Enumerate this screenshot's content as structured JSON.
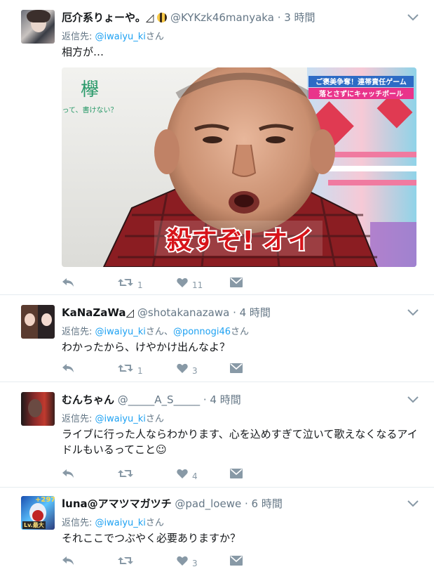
{
  "tweets": [
    {
      "name": "厄介系りょーや。◿",
      "handle": "@KYKzk46manyaka",
      "time": "· 3 時間",
      "reply_prefix": "返信先: ",
      "reply_users": [
        "@iwaiyu_ki"
      ],
      "reply_suffix": "さん",
      "text": "相方が…",
      "retweets": "1",
      "likes": "11",
      "media": {
        "caption_main": "殺すぞ! オイ",
        "side_kanji": "欅",
        "side_text": "って、書けない？",
        "banner_line1": "ご褒美争奪！連帯責任ゲーム",
        "banner_line2": "落とさずにキャッチボール"
      }
    },
    {
      "name": "KaNaZaWa◿",
      "handle": "@shotakanazawa",
      "time": "· 4 時間",
      "reply_prefix": "返信先: ",
      "reply_users": [
        "@iwaiyu_ki",
        "@ponnogi46"
      ],
      "reply_joiner": "さん、",
      "reply_suffix": "さん",
      "text": "わかったから、けやかけ出んなよ？",
      "retweets": "1",
      "likes": "3"
    },
    {
      "name": "むんちゃん",
      "handle": "@_____A_S_____",
      "time": "· 4 時間",
      "reply_prefix": "返信先: ",
      "reply_users": [
        "@iwaiyu_ki"
      ],
      "reply_suffix": "さん",
      "text": "ライブに行った人ならわかります、心を込めすぎて泣いて歌えなくなるアイドルもいるってこと☺",
      "retweets": "",
      "likes": "4"
    },
    {
      "name": "luna@アマツマガツチ",
      "handle": "@pad_loewe",
      "time": "· 6 時間",
      "reply_prefix": "返信先: ",
      "reply_users": [
        "@iwaiyu_ki"
      ],
      "reply_suffix": "さん",
      "text": "それここでつぶやく必要ありますか？",
      "retweets": "",
      "likes": "3",
      "avatar_text": "+297",
      "avatar_level": "Lv.最大"
    }
  ],
  "icons": {
    "reply": "reply-icon",
    "retweet": "retweet-icon",
    "like": "heart-icon",
    "dm": "direct-message-icon",
    "more": "chevron-down-icon"
  },
  "colors": {
    "link": "#1da1f2",
    "muted": "#657786",
    "action": "#8899a6",
    "divider": "#e6ecf0"
  }
}
